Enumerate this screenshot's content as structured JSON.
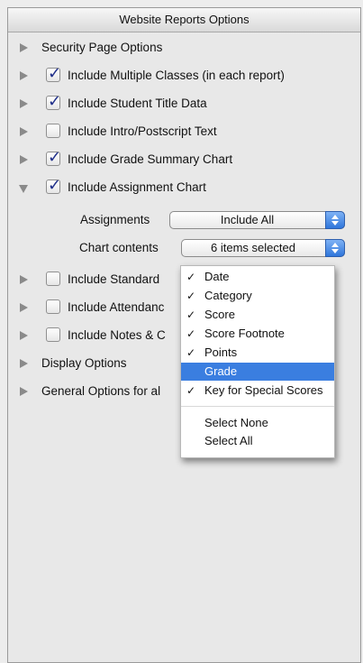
{
  "panel": {
    "title": "Website Reports Options"
  },
  "rows": {
    "security": {
      "label": "Security Page Options"
    },
    "multiple_classes": {
      "label": "Include Multiple Classes (in each report)",
      "checked": true
    },
    "student_title": {
      "label": "Include Student Title Data",
      "checked": true
    },
    "intro_postscript": {
      "label": "Include Intro/Postscript Text",
      "checked": false
    },
    "grade_summary": {
      "label": "Include Grade Summary Chart",
      "checked": true
    },
    "assignment_chart": {
      "label": "Include Assignment Chart",
      "checked": true,
      "expanded": true
    },
    "standard": {
      "label": "Include Standard",
      "checked": false
    },
    "attendance": {
      "label": "Include Attendanc",
      "checked": false
    },
    "notes": {
      "label": "Include Notes & C",
      "checked": false
    },
    "display": {
      "label": "Display Options"
    },
    "general": {
      "label": "General Options for al"
    }
  },
  "assignments": {
    "label": "Assignments",
    "value": "Include All"
  },
  "chart_contents": {
    "label": "Chart contents",
    "value": "6 items selected"
  },
  "menu": {
    "items": [
      {
        "label": "Date",
        "check": "✓"
      },
      {
        "label": "Category",
        "check": "✓"
      },
      {
        "label": "Score",
        "check": "✓"
      },
      {
        "label": "Score Footnote",
        "check": "✓"
      },
      {
        "label": "Points",
        "check": "✓"
      },
      {
        "label": "Grade",
        "check": ""
      },
      {
        "label": "Key for Special Scores",
        "check": "✓"
      }
    ],
    "actions": [
      {
        "label": "Select None"
      },
      {
        "label": "Select All"
      }
    ]
  },
  "colors": {
    "highlight": "#3a7ee0",
    "check": "#1f2f8a"
  }
}
